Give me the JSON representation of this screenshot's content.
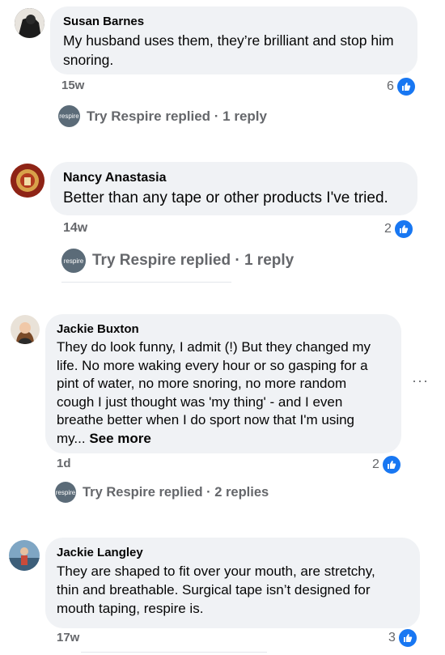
{
  "comments": [
    {
      "author": "Susan Barnes",
      "text_lines": [
        "My husband uses them, they’re brilliant and stop him",
        "snoring."
      ],
      "time": "15w",
      "likes": "6",
      "reply_label": "Try Respire replied · 1 reply",
      "reply_avatar_text": "respire"
    },
    {
      "author": "Nancy Anastasia",
      "text_lines": [
        "Better than any tape or other products I've tried."
      ],
      "time": "14w",
      "likes": "2",
      "reply_label": "Try Respire replied · 1 reply",
      "reply_avatar_text": "respire"
    },
    {
      "author": "Jackie Buxton",
      "text_lines": [
        "They do look funny, I admit (!) But they changed my",
        "life. No more waking every hour or so gasping for a",
        "pint of water, no more snoring, no more random",
        "cough I just thought was 'my thing' - and I even",
        "breathe better when I do sport now that I'm using"
      ],
      "text_last": "my...",
      "see_more": "See more",
      "time": "1d",
      "likes": "2",
      "reply_label": "Try Respire replied · 2 replies",
      "reply_avatar_text": "respire",
      "more_glyph": "···"
    },
    {
      "author": "Jackie Langley",
      "text_lines": [
        "They are shaped to fit over your mouth, are stretchy,",
        "thin and breathable. Surgical tape isn’t designed for",
        "mouth taping, respire is."
      ],
      "time": "17w",
      "likes": "3"
    }
  ],
  "colors": {
    "like_blue": "#1877f2",
    "bubble": "#f0f2f5",
    "meta": "#65676b"
  },
  "icons": {
    "like": "thumbs-up-icon",
    "more": "more-options-icon"
  }
}
